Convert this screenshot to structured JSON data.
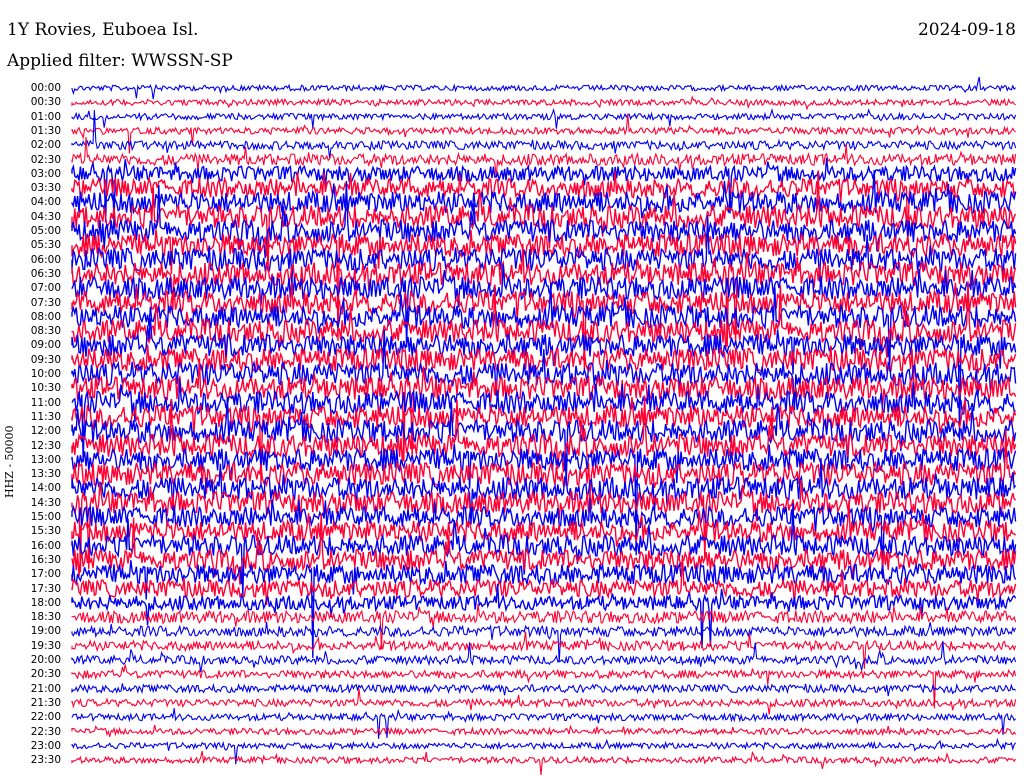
{
  "header": {
    "station": "1Y Rovies, Euboea Isl.",
    "filter": "Applied filter: WWSSN-SP",
    "date": "2024-09-18"
  },
  "colors": {
    "odd_trace": "#0000ee",
    "even_trace": "#ff0033",
    "background": "#ffffff"
  },
  "chart_data": {
    "type": "line",
    "subtype": "helicorder",
    "ylabel": "HHZ - 50000",
    "row_labels": [
      "00:00",
      "00:30",
      "01:00",
      "01:30",
      "02:00",
      "02:30",
      "03:00",
      "03:30",
      "04:00",
      "04:30",
      "05:00",
      "05:30",
      "06:00",
      "06:30",
      "07:00",
      "07:30",
      "08:00",
      "08:30",
      "09:00",
      "09:30",
      "10:00",
      "10:30",
      "11:00",
      "11:30",
      "12:00",
      "12:30",
      "13:00",
      "13:30",
      "14:00",
      "14:30",
      "15:00",
      "15:30",
      "16:00",
      "16:30",
      "17:00",
      "17:30",
      "18:00",
      "18:30",
      "19:00",
      "19:30",
      "20:00",
      "20:30",
      "21:00",
      "21:30",
      "22:00",
      "22:30",
      "23:00",
      "23:30"
    ],
    "row_minutes": 30,
    "noise_level": [
      0.08,
      0.1,
      0.12,
      0.15,
      0.25,
      0.4,
      0.6,
      0.8,
      0.95,
      1.0,
      1.0,
      1.0,
      1.0,
      1.0,
      1.0,
      1.0,
      1.0,
      1.0,
      1.0,
      1.0,
      1.0,
      1.0,
      1.0,
      1.0,
      1.0,
      1.0,
      1.0,
      1.0,
      1.0,
      0.95,
      0.9,
      0.9,
      0.9,
      0.9,
      0.85,
      0.7,
      0.55,
      0.45,
      0.35,
      0.3,
      0.25,
      0.22,
      0.2,
      0.18,
      0.15,
      0.12,
      0.12,
      0.12
    ],
    "grid": false
  }
}
